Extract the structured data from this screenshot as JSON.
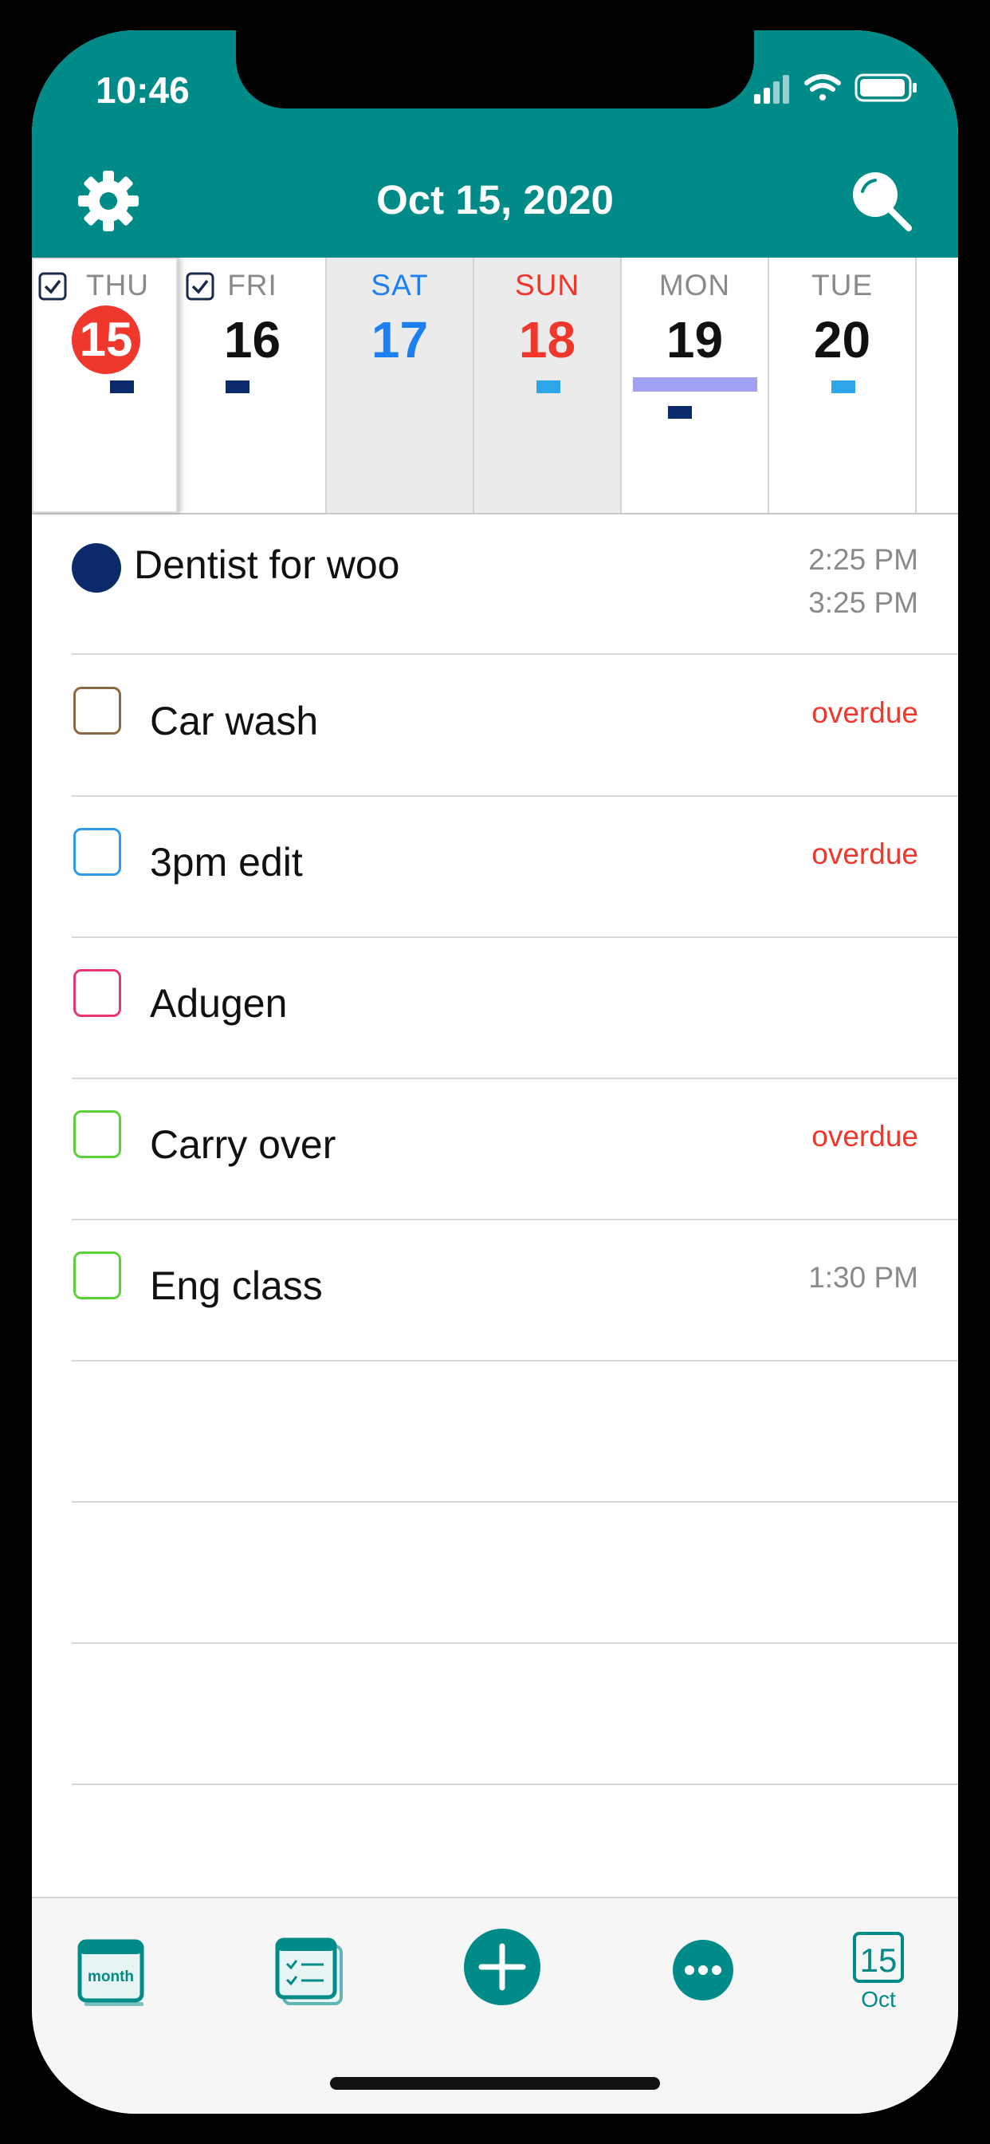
{
  "status_bar": {
    "time": "10:46"
  },
  "header": {
    "title": "Oct 15, 2020"
  },
  "week": [
    {
      "name": "THU",
      "number": "15",
      "today": true,
      "checked": true
    },
    {
      "name": "FRI",
      "number": "16",
      "checked": true
    },
    {
      "name": "SAT",
      "number": "17"
    },
    {
      "name": "SUN",
      "number": "18"
    },
    {
      "name": "MON",
      "number": "19"
    },
    {
      "name": "TUE",
      "number": "20"
    }
  ],
  "list": [
    {
      "type": "event",
      "title": "Dentist for woo",
      "start": "2:25 PM",
      "end": "3:25 PM",
      "color": "#0a2a6b"
    },
    {
      "type": "task",
      "title": "Car wash",
      "status": "overdue",
      "color": "#8a6a44"
    },
    {
      "type": "task",
      "title": "3pm edit",
      "status": "overdue",
      "color": "#2e9be8"
    },
    {
      "type": "task",
      "title": "Adugen",
      "status": "",
      "color": "#e8356e"
    },
    {
      "type": "task",
      "title": "Carry over",
      "status": "overdue",
      "color": "#5ad23a"
    },
    {
      "type": "task",
      "title": "Eng class",
      "time": "1:30 PM",
      "color": "#5ad23a"
    }
  ],
  "tabbar": {
    "month_label": "month",
    "date_number": "15",
    "date_month": "Oct"
  },
  "colors": {
    "accent": "#008b88",
    "today_red": "#f0372b",
    "sat_blue": "#1e7ff0",
    "sun_red": "#f0372b",
    "overdue": "#f0372b"
  }
}
